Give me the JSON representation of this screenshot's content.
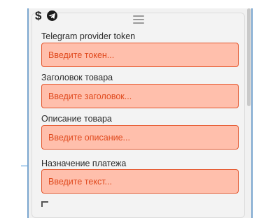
{
  "header": {
    "currency_symbol": "$",
    "messenger_icon": "telegram-icon",
    "drag_icon": "drag-handle-icon"
  },
  "fields": [
    {
      "label": "Telegram provider token",
      "placeholder": "Введите токен..."
    },
    {
      "label": "Заголовок товара",
      "placeholder": "Введите заголовок..."
    },
    {
      "label": "Описание товара",
      "placeholder": "Введите описание..."
    },
    {
      "label": "Назначение платежа",
      "placeholder": "Введите текст..."
    }
  ],
  "colors": {
    "input_background": "#ffbfac",
    "input_border": "#e4572e",
    "input_text": "#e04a1e",
    "node_border": "#7aa6cf"
  }
}
